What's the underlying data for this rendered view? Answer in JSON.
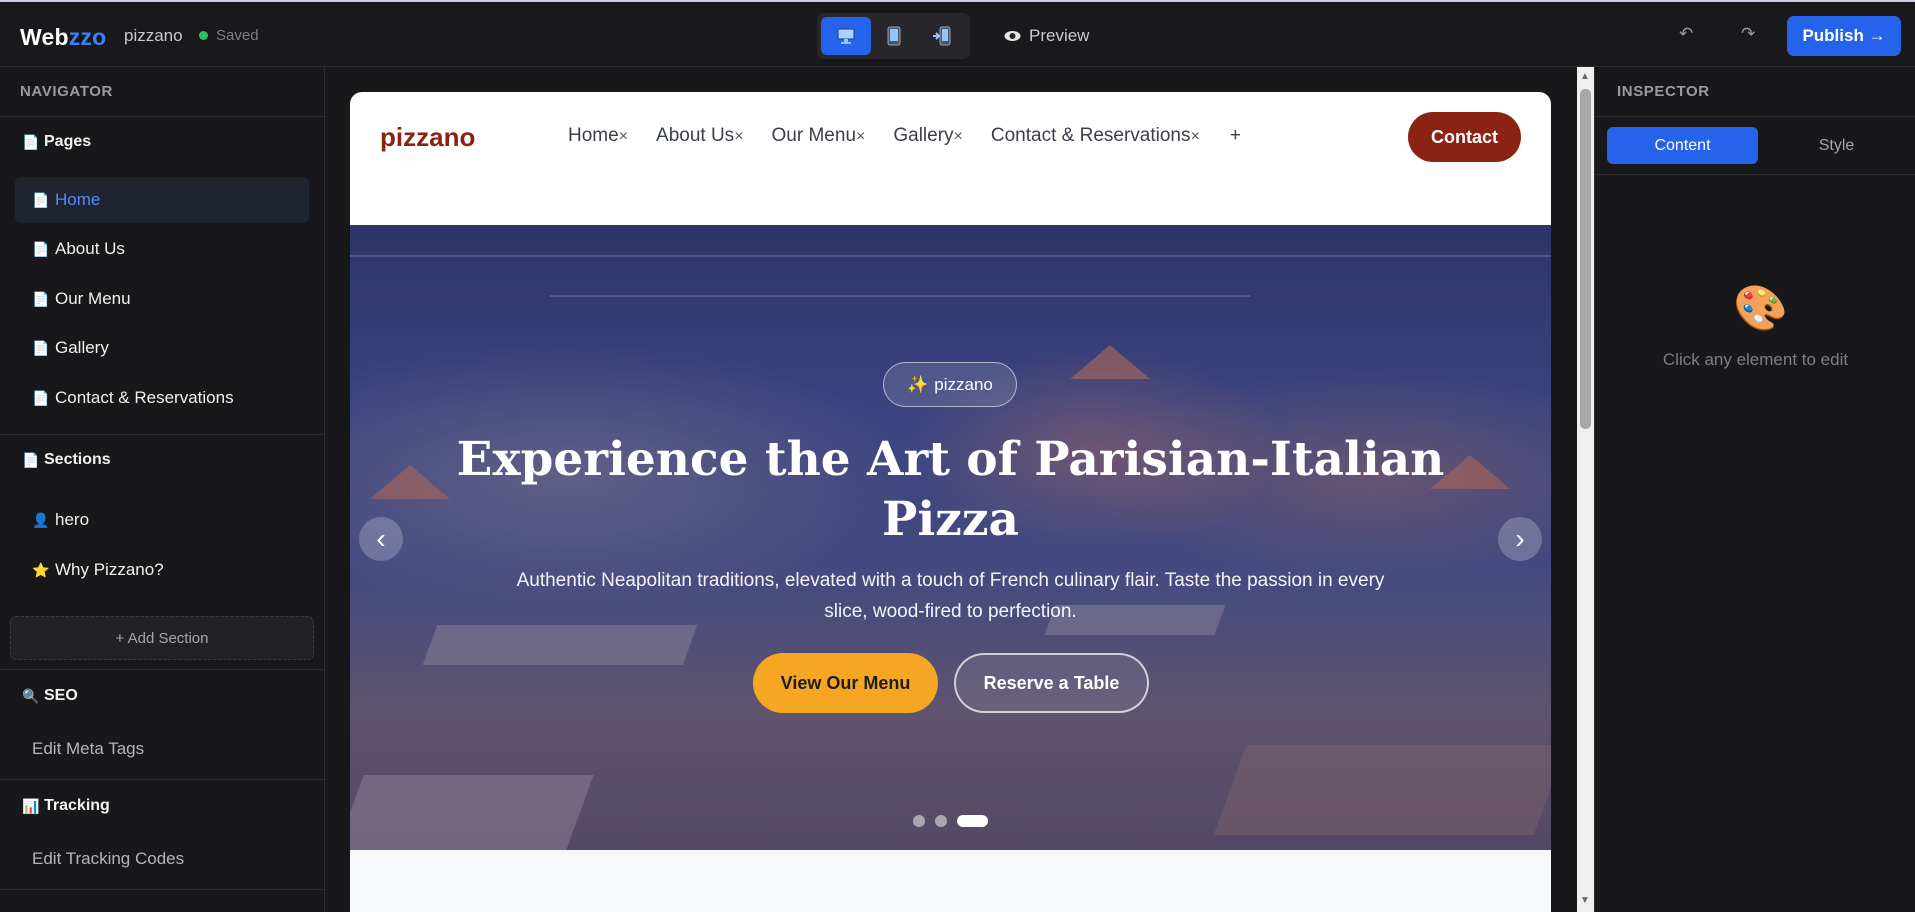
{
  "topbar": {
    "brand_main": "Web",
    "brand_accent": "zzo",
    "project_name": "pizzano",
    "status": "Saved",
    "preview_label": "Preview",
    "undo_glyph": "↶",
    "redo_glyph": "↷",
    "publish_label": "Publish →",
    "devices": [
      "desktop-icon",
      "tablet-icon",
      "mobile-icon"
    ]
  },
  "navigator": {
    "title": "NAVIGATOR",
    "pages_heading": "Pages",
    "pages": [
      {
        "label": "Home",
        "active": true
      },
      {
        "label": "About Us"
      },
      {
        "label": "Our Menu"
      },
      {
        "label": "Gallery"
      },
      {
        "label": "Contact & Reservations"
      }
    ],
    "sections_heading": "Sections",
    "sections": [
      {
        "label": "hero",
        "icon": "person-icon"
      },
      {
        "label": "Why Pizzano?",
        "icon": "star-icon"
      }
    ],
    "add_section_label": "+ Add Section",
    "seo_heading": "SEO",
    "seo_link": "Edit Meta Tags",
    "tracking_heading": "Tracking",
    "tracking_link": "Edit Tracking Codes"
  },
  "site": {
    "logo": "pizzano",
    "nav": [
      "Home",
      "About Us",
      "Our Menu",
      "Gallery",
      "Contact & Reservations"
    ],
    "nav_remove_glyph": "×",
    "nav_add_glyph": "+",
    "contact_label": "Contact",
    "hero": {
      "badge": "pizzano",
      "title": "Experience the Art of Parisian-Italian Pizza",
      "subtitle": "Authentic Neapolitan traditions, elevated with a touch of French culinary flair. Taste the passion in every slice, wood-fired to perfection.",
      "primary_cta": "View Our Menu",
      "secondary_cta": "Reserve a Table",
      "prev_glyph": "‹",
      "next_glyph": "›",
      "slide_count": 3,
      "active_slide": 3
    }
  },
  "inspector": {
    "title": "INSPECTOR",
    "tab_content": "Content",
    "tab_style": "Style",
    "hint": "Click any element to edit"
  },
  "colors": {
    "accent": "#2563eb",
    "brand_red": "#8b2314",
    "cta_orange": "#f5a623",
    "saved_green": "#22c55e"
  }
}
